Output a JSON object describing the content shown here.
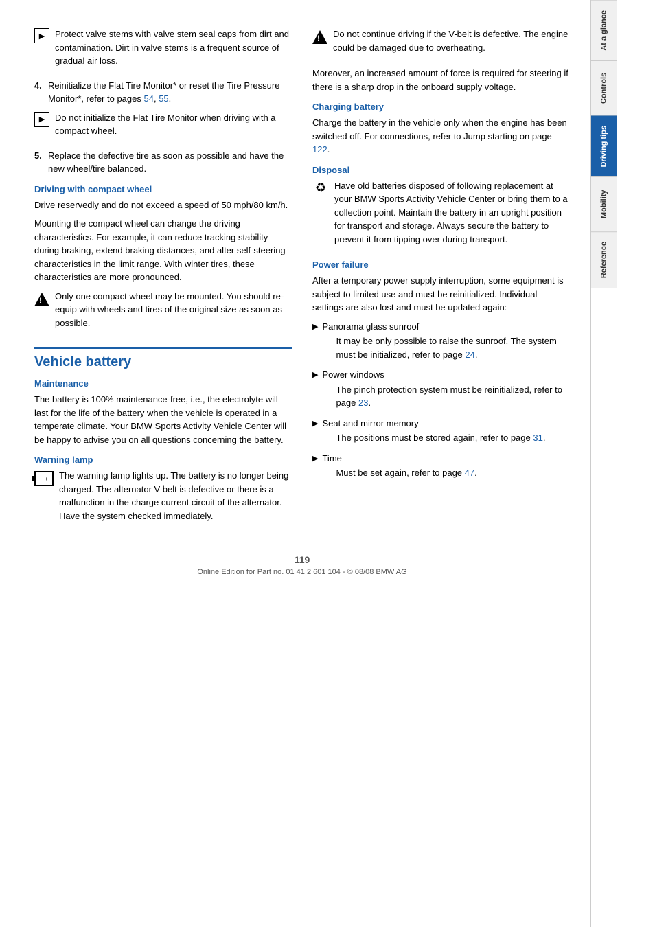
{
  "page": {
    "number": "119",
    "footer": "Online Edition for Part no. 01 41 2 601 104 - © 08/08 BMW AG"
  },
  "tabs": [
    {
      "id": "at-a-glance",
      "label": "At a glance",
      "active": false
    },
    {
      "id": "controls",
      "label": "Controls",
      "active": false
    },
    {
      "id": "driving-tips",
      "label": "Driving tips",
      "active": true
    },
    {
      "id": "mobility",
      "label": "Mobility",
      "active": false
    },
    {
      "id": "reference",
      "label": "Reference",
      "active": false
    }
  ],
  "left_col": {
    "note1": {
      "text": "Protect valve stems with valve stem seal caps from dirt and contamination. Dirt in valve stems is a frequent source of gradual air loss."
    },
    "step4": {
      "text": "Reinitialize the Flat Tire Monitor",
      "text2": " or reset the Tire Pressure Monitor",
      "text3": ", refer to pages ",
      "pages": [
        "54",
        "55"
      ],
      "star": "*"
    },
    "note2": {
      "text": "Do not initialize the Flat Tire Monitor when driving with a compact wheel."
    },
    "step5": {
      "text": "Replace the defective tire as soon as possible and have the new wheel/tire balanced."
    },
    "driving_compact": {
      "title": "Driving with compact wheel",
      "p1": "Drive reservedly and do not exceed a speed of 50 mph/80 km/h.",
      "p2": "Mounting the compact wheel can change the driving characteristics. For example, it can reduce tracking stability during braking, extend braking distances, and alter self-steering characteristics in the limit range. With winter tires, these characteristics are more pronounced.",
      "warning": "Only one compact wheel may be mounted. You should re-equip with wheels and tires of the original size as soon as possible."
    },
    "vehicle_battery": {
      "title": "Vehicle battery",
      "maintenance": {
        "title": "Maintenance",
        "text": "The battery is 100% maintenance-free, i.e., the electrolyte will last for the life of the battery when the vehicle is operated in a temperate climate. Your BMW Sports Activity Vehicle Center will be happy to advise you on all questions concerning the battery."
      },
      "warning_lamp": {
        "title": "Warning lamp",
        "text": "The warning lamp lights up. The battery is no longer being charged. The alternator V-belt is defective or there is a malfunction in the charge current circuit of the alternator. Have the system checked immediately."
      }
    }
  },
  "right_col": {
    "vbelt_warning": {
      "text": "Do not continue driving if the V-belt is defective. The engine could be damaged due to overheating.",
      "text2": "Moreover, an increased amount of force is required for steering if there is a sharp drop in the onboard supply voltage."
    },
    "charging_battery": {
      "title": "Charging battery",
      "text": "Charge the battery in the vehicle only when the engine has been switched off. For connections, refer to Jump starting on page ",
      "page": "122"
    },
    "disposal": {
      "title": "Disposal",
      "text": "Have old batteries disposed of following replacement at your BMW Sports Activity Vehicle Center or bring them to a collection point. Maintain the battery in an upright position for transport and storage. Always secure the battery to prevent it from tipping over during transport."
    },
    "power_failure": {
      "title": "Power failure",
      "intro": "After a temporary power supply interruption, some equipment is subject to limited use and must be reinitialized. Individual settings are also lost and must be updated again:",
      "items": [
        {
          "label": "Panorama glass sunroof",
          "detail": "It may be only possible to raise the sunroof. The system must be initialized, refer to page ",
          "page": "24"
        },
        {
          "label": "Power windows",
          "detail": "The pinch protection system must be reinitialized, refer to page ",
          "page": "23"
        },
        {
          "label": "Seat and mirror memory",
          "detail": "The positions must be stored again, refer to page ",
          "page": "31"
        },
        {
          "label": "Time",
          "detail": "Must be set again, refer to page ",
          "page": "47"
        }
      ]
    }
  }
}
